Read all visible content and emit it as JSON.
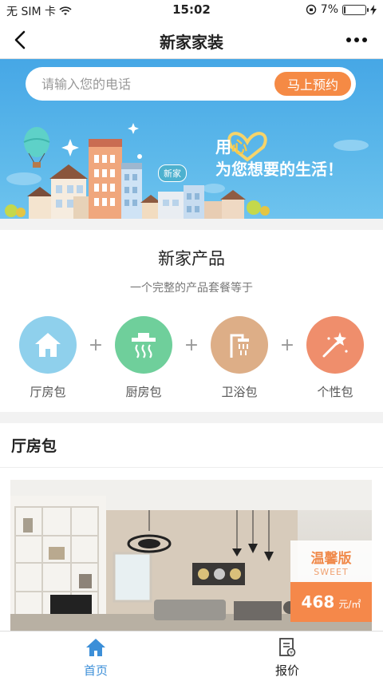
{
  "status_bar": {
    "carrier": "无 SIM 卡",
    "time": "15:02",
    "battery": "7%",
    "battery_level": 0.07
  },
  "nav": {
    "title": "新家家装"
  },
  "banner": {
    "search_placeholder": "请输入您的电话",
    "book_button": "马上预约",
    "badge": "新家",
    "slogan_line1_a": "用",
    "slogan_line1_b": "心",
    "slogan_line2": "为您想要的生活！"
  },
  "products": {
    "title": "新家产品",
    "subtitle": "一个完整的产品套餐等于",
    "plus": "+",
    "items": [
      {
        "label": "厅房包",
        "icon": "house-icon",
        "color": "#8fd0ec"
      },
      {
        "label": "厨房包",
        "icon": "range-hood-icon",
        "color": "#6fcf9b"
      },
      {
        "label": "卫浴包",
        "icon": "shower-icon",
        "color": "#ddae87"
      },
      {
        "label": "个性包",
        "icon": "magic-wand-icon",
        "color": "#ef8e6c"
      }
    ]
  },
  "section": {
    "title": "厅房包",
    "card": {
      "tier_cn": "温馨版",
      "tier_en": "SWEET",
      "price": "468",
      "unit": "元/㎡"
    }
  },
  "tabbar": {
    "items": [
      {
        "label": "首页",
        "icon": "home-icon",
        "active": true
      },
      {
        "label": "报价",
        "icon": "quote-icon",
        "active": false
      }
    ],
    "active_color": "#3c8fd8"
  }
}
